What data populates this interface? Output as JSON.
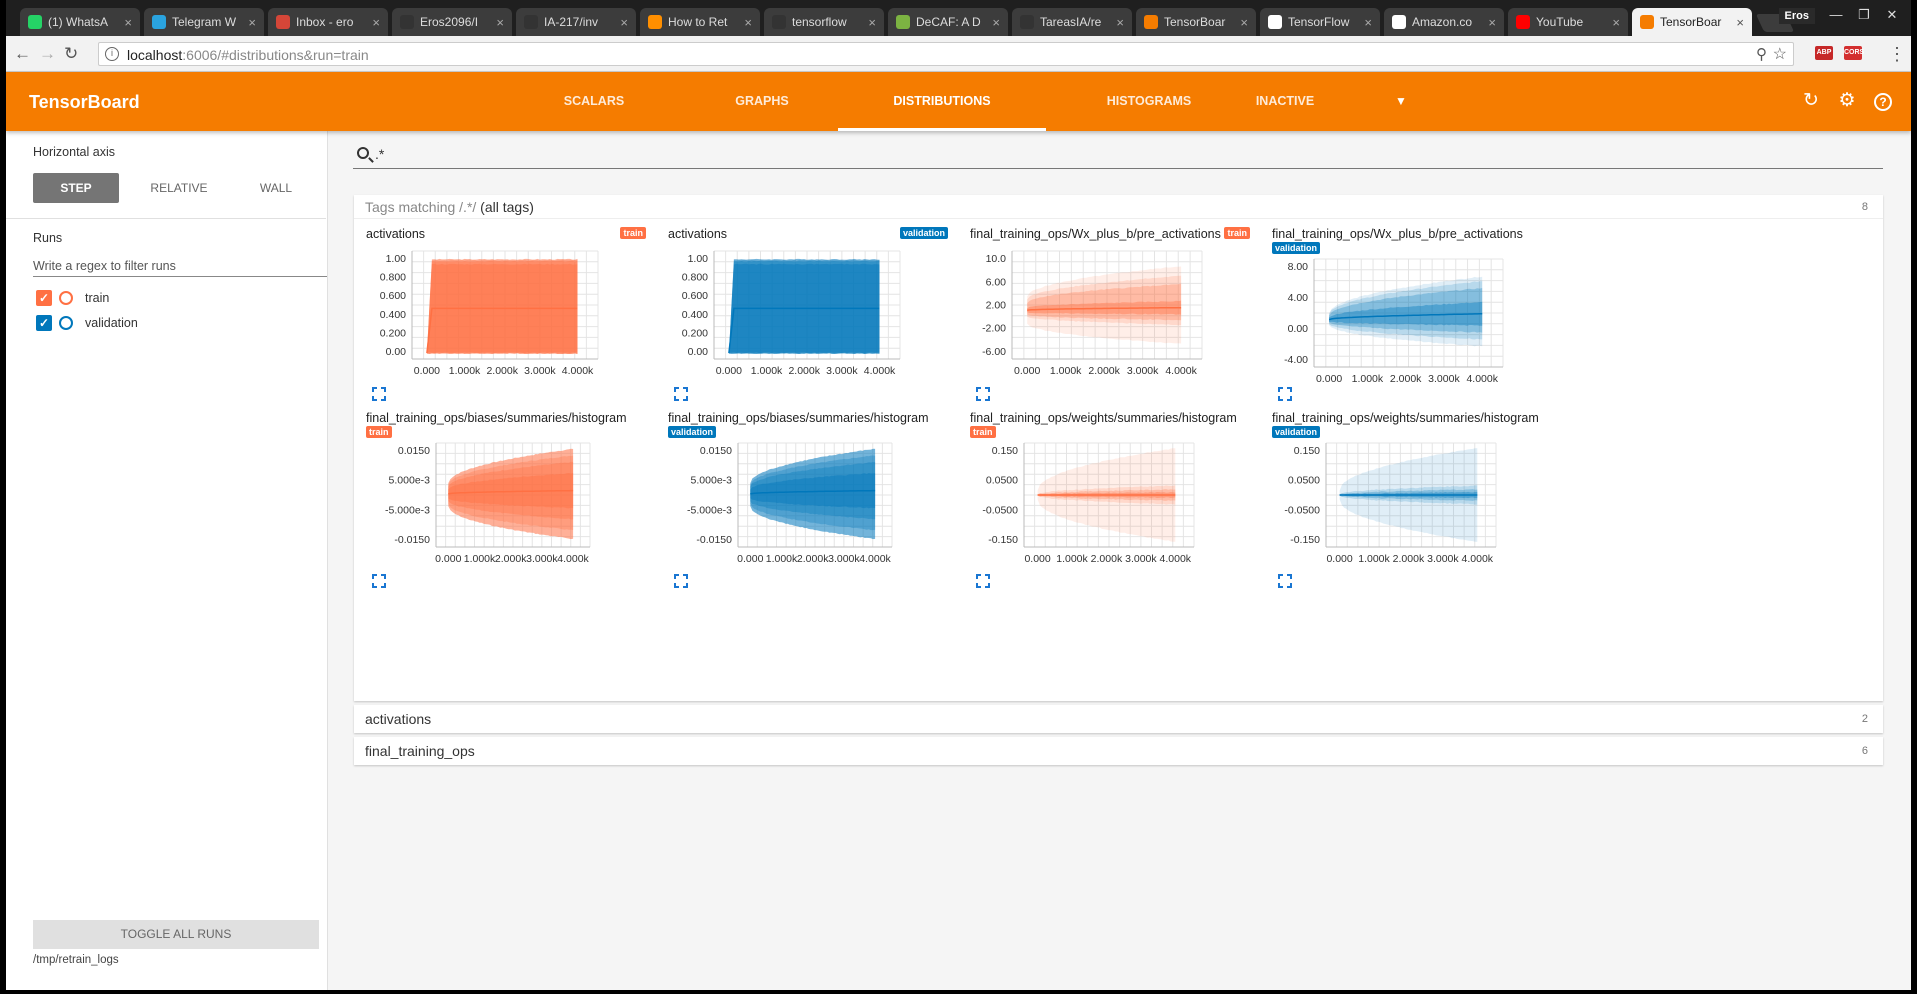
{
  "browser": {
    "tabs": [
      {
        "title": "(1) WhatsA",
        "icon": "whatsapp-icon",
        "color": "#25d366"
      },
      {
        "title": "Telegram W",
        "icon": "telegram-icon",
        "color": "#2aa3df"
      },
      {
        "title": "Inbox - ero",
        "icon": "gmail-icon",
        "color": "#d44638"
      },
      {
        "title": "Eros2096/I",
        "icon": "github-icon",
        "color": "#333333"
      },
      {
        "title": "IA-217/inv",
        "icon": "github-icon",
        "color": "#333333"
      },
      {
        "title": "How to Ret",
        "icon": "tensorflow-icon",
        "color": "#ff8f00"
      },
      {
        "title": "tensorflow",
        "icon": "github-icon",
        "color": "#333333"
      },
      {
        "title": "DeCAF: A D",
        "icon": "decaf-icon",
        "color": "#7cb342"
      },
      {
        "title": "TareasIA/re",
        "icon": "github-icon",
        "color": "#333333"
      },
      {
        "title": "TensorBoar",
        "icon": "tensorboard-icon",
        "color": "#f57c00"
      },
      {
        "title": "TensorFlow",
        "icon": "tensorflow-icon",
        "color": "#ffffff"
      },
      {
        "title": "Amazon.co",
        "icon": "amazon-icon",
        "color": "#ffffff"
      },
      {
        "title": "YouTube",
        "icon": "youtube-icon",
        "color": "#ff0000"
      },
      {
        "title": "TensorBoar",
        "icon": "tensorboard-icon",
        "color": "#f57c00"
      }
    ],
    "profile": "Eros",
    "url_host": "localhost",
    "url_rest": ":6006/#distributions&run=train",
    "extensions": [
      "ABP",
      "CORS"
    ]
  },
  "app": {
    "title": "TensorBoard",
    "nav": [
      "SCALARS",
      "GRAPHS",
      "DISTRIBUTIONS",
      "HISTOGRAMS",
      "INACTIVE"
    ],
    "selected_nav": "DISTRIBUTIONS",
    "accent": "#f57c00"
  },
  "sidebar": {
    "axis_label": "Horizontal axis",
    "axis_options": [
      "STEP",
      "RELATIVE",
      "WALL"
    ],
    "axis_selected": "STEP",
    "runs_label": "Runs",
    "filter_placeholder": "Write a regex to filter runs",
    "runs": [
      {
        "name": "train",
        "color": "#ff7043",
        "checked": true
      },
      {
        "name": "validation",
        "color": "#0077bb",
        "checked": true
      }
    ],
    "toggle_label": "TOGGLE ALL RUNS",
    "logdir": "/tmp/retrain_logs"
  },
  "main": {
    "search_query": ".*",
    "tags_pane": {
      "prefix": "Tags matching /.*/",
      "suffix": "(all tags)",
      "count": "8"
    },
    "groups": [
      {
        "name": "activations",
        "count": "2"
      },
      {
        "name": "final_training_ops",
        "count": "6"
      }
    ]
  },
  "run_colors": {
    "train": "#ff7043",
    "validation": "#0077bb"
  },
  "chart_data": [
    {
      "type": "area",
      "title": "activations",
      "run": "train",
      "x_ticks": [
        "0.000",
        "1.000k",
        "2.000k",
        "3.000k",
        "4.000k"
      ],
      "y_ticks": [
        "0.00",
        "0.200",
        "0.400",
        "0.600",
        "0.800",
        "1.00"
      ],
      "xlim": [
        0,
        4000
      ],
      "ylim": [
        0,
        1
      ],
      "grid": true
    },
    {
      "type": "area",
      "title": "activations",
      "run": "validation",
      "x_ticks": [
        "0.000",
        "1.000k",
        "2.000k",
        "3.000k",
        "4.000k"
      ],
      "y_ticks": [
        "0.00",
        "0.200",
        "0.400",
        "0.600",
        "0.800",
        "1.00"
      ],
      "xlim": [
        0,
        4000
      ],
      "ylim": [
        0,
        1
      ],
      "grid": true
    },
    {
      "type": "area",
      "title": "final_training_ops/Wx_plus_b/pre_activations",
      "run": "train",
      "x_ticks": [
        "0.000",
        "1.000k",
        "2.000k",
        "3.000k",
        "4.000k"
      ],
      "y_ticks": [
        "-6.00",
        "-2.00",
        "2.00",
        "6.00",
        "10.0"
      ],
      "xlim": [
        0,
        4000
      ],
      "ylim": [
        -8,
        12
      ],
      "grid": true
    },
    {
      "type": "area",
      "title": "final_training_ops/Wx_plus_b/pre_activations",
      "run": "validation",
      "x_ticks": [
        "0.000",
        "1.000k",
        "2.000k",
        "3.000k",
        "4.000k"
      ],
      "y_ticks": [
        "-4.00",
        "0.00",
        "4.00",
        "8.00"
      ],
      "xlim": [
        0,
        4000
      ],
      "ylim": [
        -6,
        10
      ],
      "grid": true
    },
    {
      "type": "area",
      "title": "final_training_ops/biases/summaries/histogram",
      "run": "train",
      "x_ticks": [
        "0.000",
        "1.000k",
        "2.000k",
        "3.000k",
        "4.000k"
      ],
      "y_ticks": [
        "-0.0150",
        "-5.000e-3",
        "5.000e-3",
        "0.0150"
      ],
      "xlim": [
        0,
        4000
      ],
      "ylim": [
        -0.02,
        0.02
      ],
      "grid": true
    },
    {
      "type": "area",
      "title": "final_training_ops/biases/summaries/histogram",
      "run": "validation",
      "x_ticks": [
        "0.000",
        "1.000k",
        "2.000k",
        "3.000k",
        "4.000k"
      ],
      "y_ticks": [
        "-0.0150",
        "-5.000e-3",
        "5.000e-3",
        "0.0150"
      ],
      "xlim": [
        0,
        4000
      ],
      "ylim": [
        -0.02,
        0.02
      ],
      "grid": true
    },
    {
      "type": "area",
      "title": "final_training_ops/weights/summaries/histogram",
      "run": "train",
      "x_ticks": [
        "0.000",
        "1.000k",
        "2.000k",
        "3.000k",
        "4.000k"
      ],
      "y_ticks": [
        "-0.150",
        "-0.0500",
        "0.0500",
        "0.150"
      ],
      "xlim": [
        0,
        4000
      ],
      "ylim": [
        -0.2,
        0.2
      ],
      "grid": true
    },
    {
      "type": "area",
      "title": "final_training_ops/weights/summaries/histogram",
      "run": "validation",
      "x_ticks": [
        "0.000",
        "1.000k",
        "2.000k",
        "3.000k",
        "4.000k"
      ],
      "y_ticks": [
        "-0.150",
        "-0.0500",
        "0.0500",
        "0.150"
      ],
      "xlim": [
        0,
        4000
      ],
      "ylim": [
        -0.2,
        0.2
      ],
      "grid": true
    }
  ]
}
